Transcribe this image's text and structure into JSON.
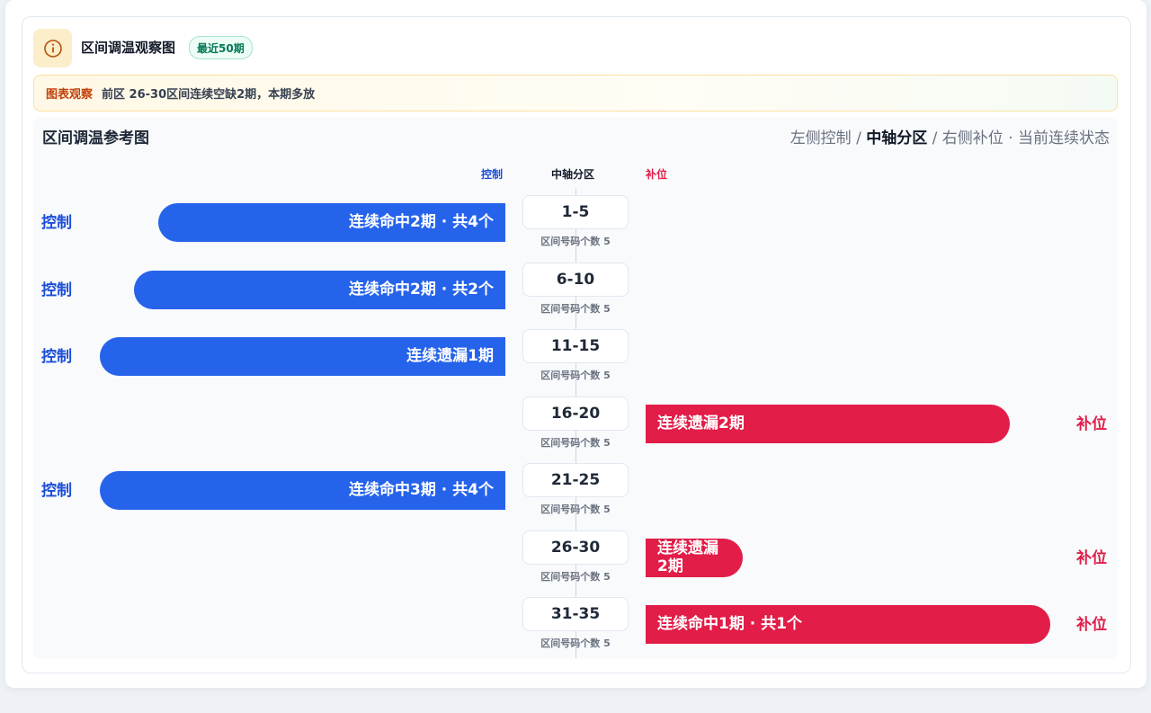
{
  "header": {
    "title": "区间调温观察图",
    "badge": "最近50期",
    "icon": "info-icon"
  },
  "observation": {
    "label": "图表观察",
    "text": "前区 26-30区间连续空缺2期，本期多放"
  },
  "panel": {
    "title": "区间调温参考图",
    "legend": {
      "left": "左侧控制",
      "sep1": " / ",
      "center": "中轴分区",
      "sep2": " / ",
      "right": "右侧补位",
      "dot": " · ",
      "state": "当前连续状态"
    }
  },
  "colors": {
    "control": "#2563eb",
    "fill": "#e11d48",
    "accent": "#d97706"
  },
  "chart_data": {
    "type": "bar",
    "column_headers": {
      "left": "控制",
      "center": "中轴分区",
      "right": "补位"
    },
    "rows": [
      {
        "zone": "1-5",
        "count_label": "区间号码个数 5",
        "side": "control",
        "side_label": "控制",
        "text": "连续命中2期 · 共4个",
        "magnitude": 0.855
      },
      {
        "zone": "6-10",
        "count_label": "区间号码个数 5",
        "side": "control",
        "side_label": "控制",
        "text": "连续命中2期 · 共2个",
        "magnitude": 0.915
      },
      {
        "zone": "11-15",
        "count_label": "区间号码个数 5",
        "side": "control",
        "side_label": "控制",
        "text": "连续遗漏1期",
        "magnitude": 1.0
      },
      {
        "zone": "16-20",
        "count_label": "区间号码个数 5",
        "side": "fill",
        "side_label": "补位",
        "text": "连续遗漏2期",
        "magnitude": 0.9
      },
      {
        "zone": "21-25",
        "count_label": "区间号码个数 5",
        "side": "control",
        "side_label": "控制",
        "text": "连续命中3期 · 共4个",
        "magnitude": 1.0
      },
      {
        "zone": "26-30",
        "count_label": "区间号码个数 5",
        "side": "fill",
        "side_label": "补位",
        "text": "连续遗漏2期",
        "magnitude": 0.24
      },
      {
        "zone": "31-35",
        "count_label": "区间号码个数 5",
        "side": "fill",
        "side_label": "补位",
        "text": "连续命中1期 · 共1个",
        "magnitude": 1.0
      }
    ]
  }
}
